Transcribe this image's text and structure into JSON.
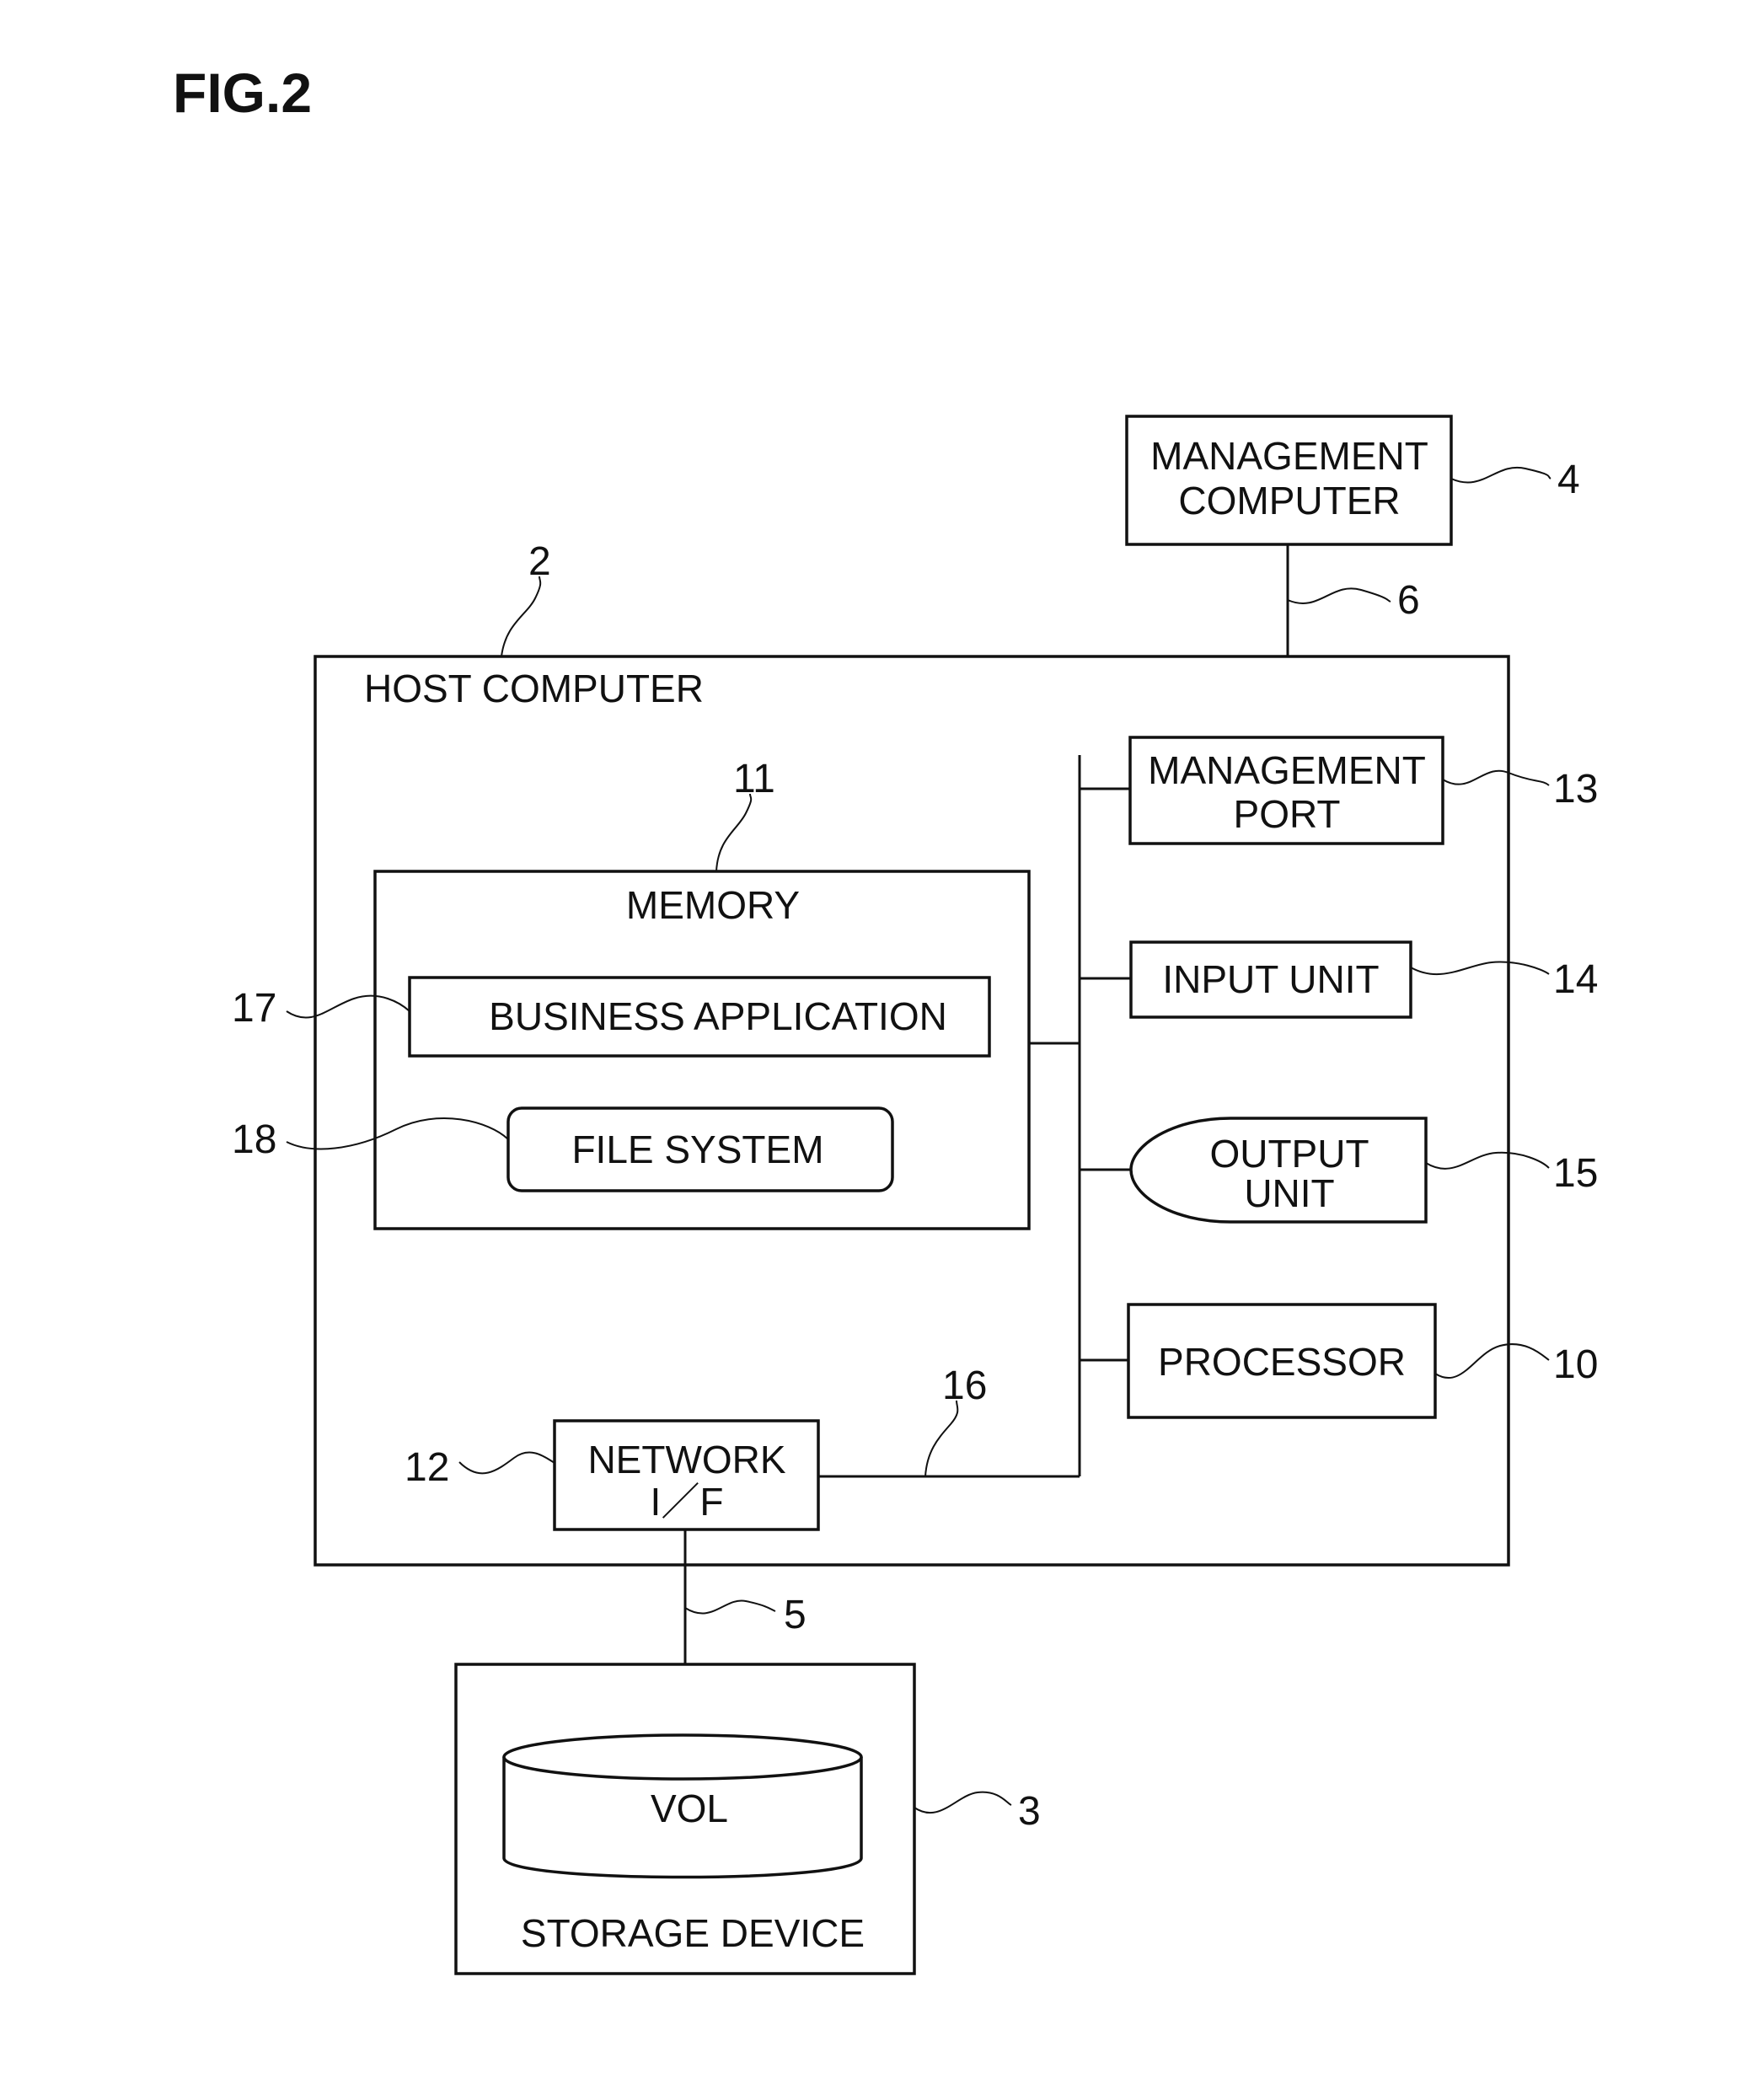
{
  "figure_title": "FIG.2",
  "nodes": {
    "management_computer": {
      "lines": [
        "MANAGEMENT",
        "COMPUTER"
      ],
      "ref": "4"
    },
    "host_computer": {
      "label": "HOST COMPUTER",
      "ref": "2"
    },
    "memory": {
      "label": "MEMORY",
      "ref": "11"
    },
    "business_application": {
      "label": "BUSINESS APPLICATION",
      "ref": "17"
    },
    "file_system": {
      "label": "FILE SYSTEM",
      "ref": "18"
    },
    "management_port": {
      "lines": [
        "MANAGEMENT",
        "PORT"
      ],
      "ref": "13"
    },
    "input_unit": {
      "label": "INPUT UNIT",
      "ref": "14"
    },
    "output_unit": {
      "lines": [
        "OUTPUT",
        "UNIT"
      ],
      "ref": "15"
    },
    "processor": {
      "label": "PROCESSOR",
      "ref": "10"
    },
    "network_if": {
      "lines": [
        "NETWORK",
        "I／F"
      ],
      "ref": "12"
    },
    "storage_device": {
      "label": "STORAGE DEVICE",
      "ref": "3"
    },
    "volume": {
      "label": "VOL"
    }
  },
  "connections": {
    "management_network": {
      "ref": "6",
      "from": "management_computer",
      "to": "management_port"
    },
    "internal_bus": {
      "ref": "16"
    },
    "storage_network": {
      "ref": "5",
      "from": "network_if",
      "to": "storage_device"
    }
  }
}
